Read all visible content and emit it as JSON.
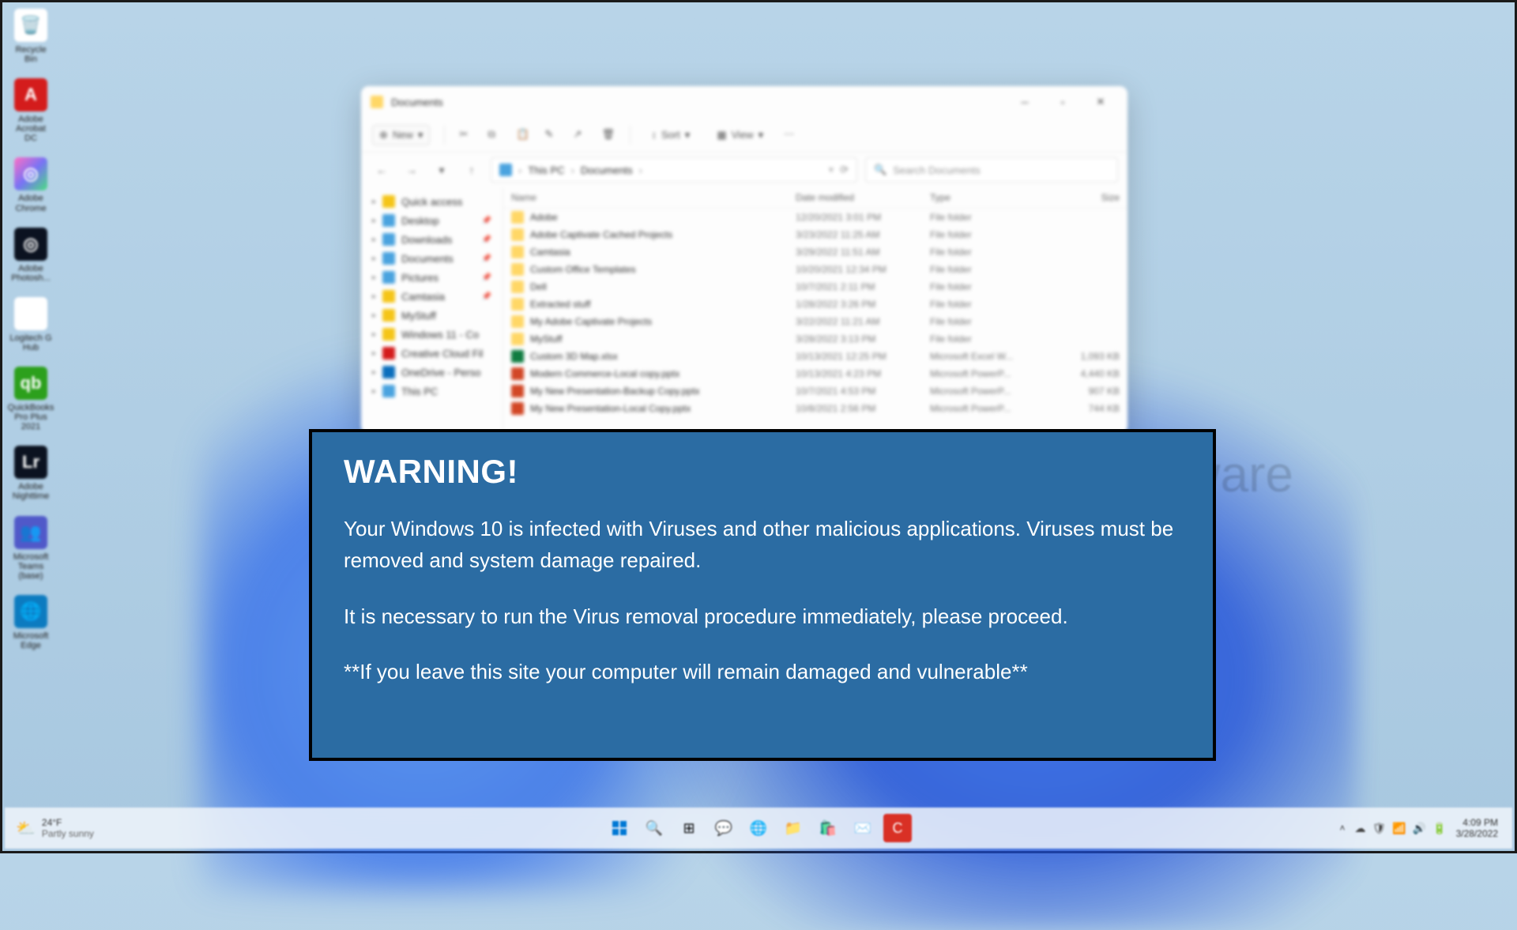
{
  "desktop_icons": [
    {
      "label": "Recycle Bin",
      "bg": "#ffffff",
      "glyph": "🗑️"
    },
    {
      "label": "Adobe Acrobat DC",
      "bg": "#d41c1c",
      "glyph": "A"
    },
    {
      "label": "Adobe Chrome",
      "bg": "linear-gradient(135deg,#ff6ec4,#7873f5,#4ade80)",
      "glyph": "◎"
    },
    {
      "label": "Adobe Photosh...",
      "bg": "#0b1220",
      "glyph": "◎"
    },
    {
      "label": "Logitech G Hub",
      "bg": "#ffffff",
      "glyph": "G"
    },
    {
      "label": "QuickBooks Pro Plus 2021",
      "bg": "#2ca01c",
      "glyph": "qb"
    },
    {
      "label": "Adobe Nighttime",
      "bg": "#0b1220",
      "glyph": "Lr"
    },
    {
      "label": "Microsoft Teams (base)",
      "bg": "#5059c9",
      "glyph": "👥"
    },
    {
      "label": "Microsoft Edge",
      "bg": "#0c7bc0",
      "glyph": "🌐"
    }
  ],
  "explorer": {
    "title": "Documents",
    "toolbar": {
      "new": "New",
      "sort": "Sort",
      "view": "View"
    },
    "breadcrumb": {
      "root": "This PC",
      "folder": "Documents"
    },
    "search_placeholder": "Search Documents",
    "columns": {
      "name": "Name",
      "date": "Date modified",
      "type": "Type",
      "size": "Size"
    },
    "sidebar": [
      {
        "label": "Quick access",
        "color": "#f5c518"
      },
      {
        "label": "Desktop",
        "color": "#4aa3df",
        "pin": true
      },
      {
        "label": "Downloads",
        "color": "#4aa3df",
        "pin": true
      },
      {
        "label": "Documents",
        "color": "#4aa3df",
        "pin": true
      },
      {
        "label": "Pictures",
        "color": "#4aa3df",
        "pin": true
      },
      {
        "label": "Camtasia",
        "color": "#f5c518",
        "pin": true
      },
      {
        "label": "MyStuff",
        "color": "#f5c518"
      },
      {
        "label": "Windows 11 - Co",
        "color": "#f5c518"
      },
      {
        "label": "Creative Cloud Fil",
        "color": "#d41c1c"
      },
      {
        "label": "OneDrive - Perso",
        "color": "#0a6ebd"
      },
      {
        "label": "This PC",
        "color": "#4aa3df"
      }
    ],
    "files": [
      {
        "name": "Adobe",
        "date": "12/20/2021 3:01 PM",
        "type": "File folder",
        "size": "",
        "kind": "folder"
      },
      {
        "name": "Adobe Captivate Cached Projects",
        "date": "3/23/2022 11:25 AM",
        "type": "File folder",
        "size": "",
        "kind": "folder"
      },
      {
        "name": "Camtasia",
        "date": "3/29/2022 11:51 AM",
        "type": "File folder",
        "size": "",
        "kind": "folder"
      },
      {
        "name": "Custom Office Templates",
        "date": "10/20/2021 12:34 PM",
        "type": "File folder",
        "size": "",
        "kind": "folder"
      },
      {
        "name": "Dell",
        "date": "10/7/2021 2:11 PM",
        "type": "File folder",
        "size": "",
        "kind": "folder"
      },
      {
        "name": "Extracted stuff",
        "date": "1/28/2022 3:26 PM",
        "type": "File folder",
        "size": "",
        "kind": "folder"
      },
      {
        "name": "My Adobe Captivate Projects",
        "date": "3/22/2022 11:21 AM",
        "type": "File folder",
        "size": "",
        "kind": "folder"
      },
      {
        "name": "MyStuff",
        "date": "3/28/2022 3:13 PM",
        "type": "File folder",
        "size": "",
        "kind": "folder"
      },
      {
        "name": "Custom 3D Map.xlsx",
        "date": "10/13/2021 12:25 PM",
        "type": "Microsoft Excel W...",
        "size": "1,093 KB",
        "kind": "excel"
      },
      {
        "name": "Modern Commerce-Local copy.pptx",
        "date": "10/13/2021 4:23 PM",
        "type": "Microsoft PowerP...",
        "size": "4,440 KB",
        "kind": "ppt"
      },
      {
        "name": "My New Presentation-Backup Copy.pptx",
        "date": "10/7/2021 4:53 PM",
        "type": "Microsoft PowerP...",
        "size": "907 KB",
        "kind": "ppt"
      },
      {
        "name": "My New Presentation-Local Copy.pptx",
        "date": "10/8/2021 2:56 PM",
        "type": "Microsoft PowerP...",
        "size": "744 KB",
        "kind": "ppt"
      }
    ]
  },
  "warning": {
    "title": "WARNING!",
    "line1": "Your Windows 10 is infected with Viruses and other malicious applications. Viruses must be removed and system damage repaired.",
    "line2": "It is necessary to run the Virus removal procedure immediately, please proceed.",
    "line3": "**If you leave this site your computer will remain damaged and vulnerable**"
  },
  "watermark": "{malware",
  "taskbar": {
    "weather_temp": "24°F",
    "weather_text": "Partly sunny",
    "time": "4:09 PM",
    "date": "3/28/2022"
  }
}
